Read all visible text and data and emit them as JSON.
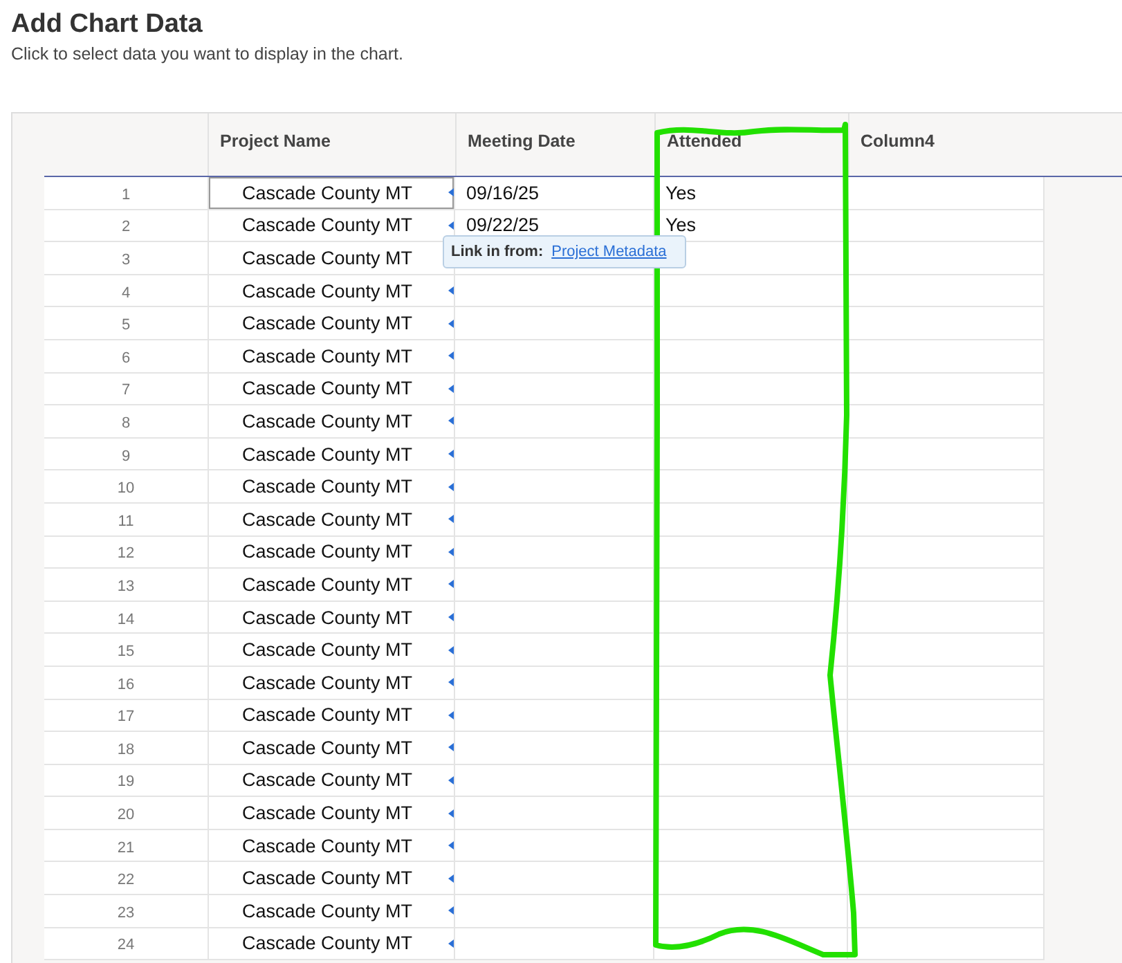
{
  "title": "Add Chart Data",
  "subtitle": "Click to select data you want to display in the chart.",
  "columns": [
    "Project Name",
    "Meeting Date",
    "Attended",
    "Column4"
  ],
  "rows": [
    {
      "number": "1",
      "project_name": "Cascade County MT",
      "meeting_date": "09/16/25",
      "attended": "Yes",
      "selected": true
    },
    {
      "number": "2",
      "project_name": "Cascade County MT",
      "meeting_date": "09/22/25",
      "attended": "Yes",
      "selected": false
    },
    {
      "number": "3",
      "project_name": "Cascade County MT",
      "selected": false
    },
    {
      "number": "4",
      "project_name": "Cascade County MT",
      "selected": false
    },
    {
      "number": "5",
      "project_name": "Cascade County MT",
      "selected": false
    },
    {
      "number": "6",
      "project_name": "Cascade County MT",
      "selected": false
    },
    {
      "number": "7",
      "project_name": "Cascade County MT",
      "selected": false
    },
    {
      "number": "8",
      "project_name": "Cascade County MT",
      "selected": false
    },
    {
      "number": "9",
      "project_name": "Cascade County MT",
      "selected": false
    },
    {
      "number": "10",
      "project_name": "Cascade County MT",
      "selected": false
    },
    {
      "number": "11",
      "project_name": "Cascade County MT",
      "selected": false
    },
    {
      "number": "12",
      "project_name": "Cascade County MT",
      "selected": false
    },
    {
      "number": "13",
      "project_name": "Cascade County MT",
      "selected": false
    },
    {
      "number": "14",
      "project_name": "Cascade County MT",
      "selected": false
    },
    {
      "number": "15",
      "project_name": "Cascade County MT",
      "selected": false
    },
    {
      "number": "16",
      "project_name": "Cascade County MT",
      "selected": false
    },
    {
      "number": "17",
      "project_name": "Cascade County MT",
      "selected": false
    },
    {
      "number": "18",
      "project_name": "Cascade County MT",
      "selected": false
    },
    {
      "number": "19",
      "project_name": "Cascade County MT",
      "selected": false
    },
    {
      "number": "20",
      "project_name": "Cascade County MT",
      "selected": false
    },
    {
      "number": "21",
      "project_name": "Cascade County MT",
      "selected": false
    },
    {
      "number": "22",
      "project_name": "Cascade County MT",
      "selected": false
    },
    {
      "number": "23",
      "project_name": "Cascade County MT",
      "selected": false
    },
    {
      "number": "24",
      "project_name": "Cascade County MT",
      "selected": false
    }
  ],
  "tooltip": {
    "label": "Link in from:",
    "link": "Project Metadata"
  }
}
